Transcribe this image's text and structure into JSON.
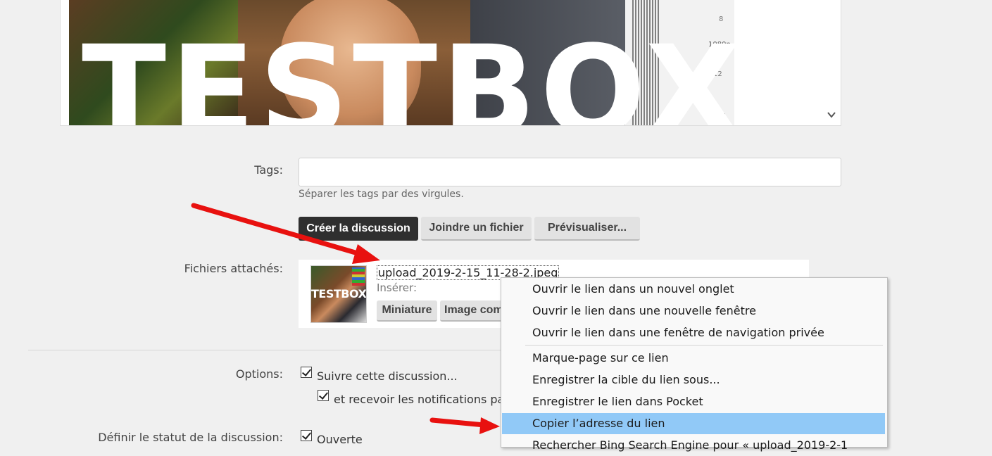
{
  "preview": {
    "overlay_text": "TESTBOX",
    "chart_resolution": "1080p\n2K",
    "chart_nums": [
      "8",
      "12",
      "1"
    ]
  },
  "form": {
    "tags_label": "Tags:",
    "tags_hint": "Séparer les tags par des virgules.",
    "buttons": {
      "create": "Créer la discussion",
      "attach": "Joindre un fichier",
      "preview": "Prévisualiser..."
    },
    "attachments_label": "Fichiers attachés:",
    "attachment": {
      "thumb_text": "TESTBOX",
      "filename": "upload_2019-2-15_11-28-2.jpeg",
      "insert_label": "Insérer:",
      "insert_thumb": "Miniature",
      "insert_full": "Image com"
    },
    "options_label": "Options:",
    "options": {
      "follow": "Suivre cette discussion...",
      "notify": "et recevoir les notifications par"
    },
    "status_label": "Définir le statut de la discussion:",
    "status_open": "Ouverte"
  },
  "context_menu": {
    "items": [
      "Ouvrir le lien dans un nouvel onglet",
      "Ouvrir le lien dans une nouvelle fenêtre",
      "Ouvrir le lien dans une fenêtre de navigation privée",
      "Marque-page sur ce lien",
      "Enregistrer la cible du lien sous...",
      "Enregistrer le lien dans Pocket",
      "Copier l’adresse du lien",
      "Rechercher Bing Search Engine pour « upload_2019-2-1"
    ],
    "highlighted_index": 6,
    "highlight_color": "#91c9f7"
  },
  "colors": {
    "primary_button": "#2f2f2f",
    "arrow": "#e8110f"
  }
}
